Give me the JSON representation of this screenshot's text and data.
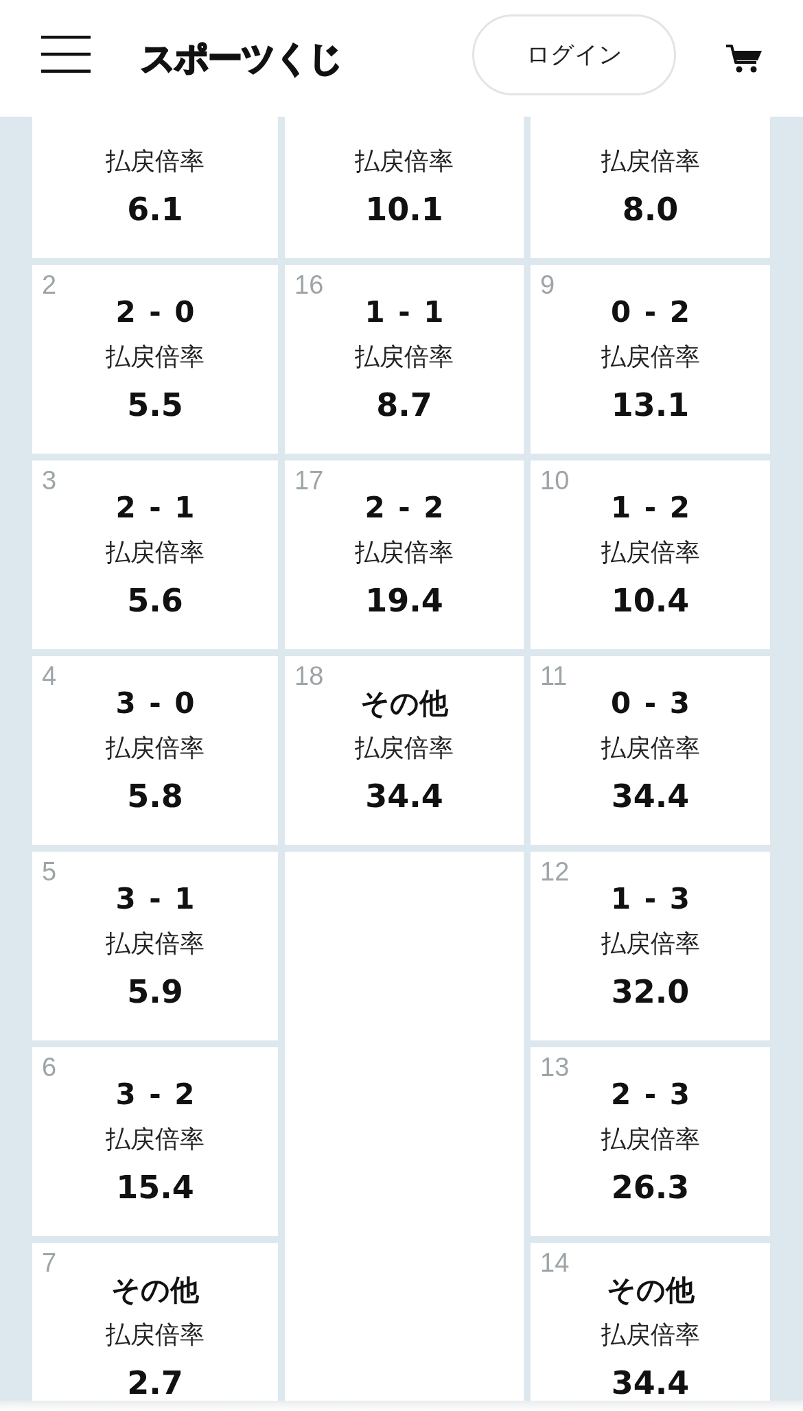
{
  "header": {
    "logo": "スポーツくじ",
    "login_button": "ログイン"
  },
  "columns": [
    {
      "cells": [
        {
          "kind": "odds",
          "ratio_label": "払戻倍率",
          "odds": "6.1"
        },
        {
          "kind": "odds",
          "no": "2",
          "score": "2 - 0",
          "ratio_label": "払戻倍率",
          "odds": "5.5"
        },
        {
          "kind": "odds",
          "no": "3",
          "score": "2 - 1",
          "ratio_label": "払戻倍率",
          "odds": "5.6"
        },
        {
          "kind": "odds",
          "no": "4",
          "score": "3 - 0",
          "ratio_label": "払戻倍率",
          "odds": "5.8"
        },
        {
          "kind": "odds",
          "no": "5",
          "score": "3 - 1",
          "ratio_label": "払戻倍率",
          "odds": "5.9"
        },
        {
          "kind": "odds",
          "no": "6",
          "score": "3 - 2",
          "ratio_label": "払戻倍率",
          "odds": "15.4"
        },
        {
          "kind": "odds",
          "no": "7",
          "score": "その他",
          "ratio_label": "払戻倍率",
          "odds": "2.7"
        }
      ]
    },
    {
      "cells": [
        {
          "kind": "odds",
          "ratio_label": "払戻倍率",
          "odds": "10.1"
        },
        {
          "kind": "odds",
          "no": "16",
          "score": "1 - 1",
          "ratio_label": "払戻倍率",
          "odds": "8.7"
        },
        {
          "kind": "odds",
          "no": "17",
          "score": "2 - 2",
          "ratio_label": "払戻倍率",
          "odds": "19.4"
        },
        {
          "kind": "odds",
          "no": "18",
          "score": "その他",
          "ratio_label": "払戻倍率",
          "odds": "34.4"
        },
        {
          "kind": "blank"
        }
      ]
    },
    {
      "cells": [
        {
          "kind": "odds",
          "ratio_label": "払戻倍率",
          "odds": "8.0"
        },
        {
          "kind": "odds",
          "no": "9",
          "score": "0 - 2",
          "ratio_label": "払戻倍率",
          "odds": "13.1"
        },
        {
          "kind": "odds",
          "no": "10",
          "score": "1 - 2",
          "ratio_label": "払戻倍率",
          "odds": "10.4"
        },
        {
          "kind": "odds",
          "no": "11",
          "score": "0 - 3",
          "ratio_label": "払戻倍率",
          "odds": "34.4"
        },
        {
          "kind": "odds",
          "no": "12",
          "score": "1 - 3",
          "ratio_label": "払戻倍率",
          "odds": "32.0"
        },
        {
          "kind": "odds",
          "no": "13",
          "score": "2 - 3",
          "ratio_label": "払戻倍率",
          "odds": "26.3"
        },
        {
          "kind": "odds",
          "no": "14",
          "score": "その他",
          "ratio_label": "払戻倍率",
          "odds": "34.4"
        }
      ]
    }
  ]
}
